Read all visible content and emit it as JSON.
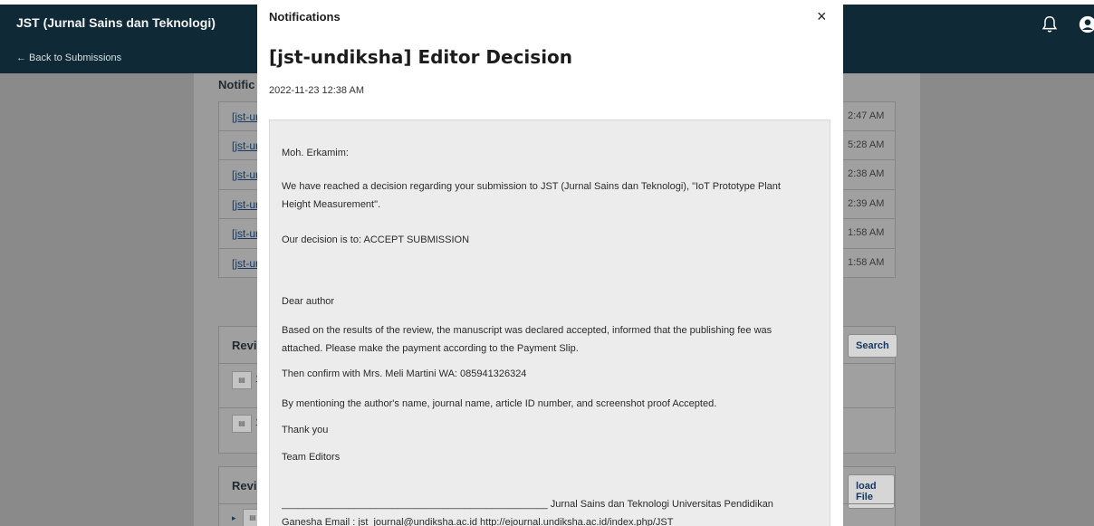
{
  "app": {
    "title": "JST (Jurnal Sains dan Teknologi)",
    "back_label": "← Back to Submissions"
  },
  "background": {
    "notifications_heading": "Notific",
    "rows": [
      {
        "link": "[jst-ur",
        "time": "2:47 AM"
      },
      {
        "link": "[jst-ur",
        "time": "5:28 AM"
      },
      {
        "link": "[jst-ur",
        "time": "2:38 AM"
      },
      {
        "link": "[jst-ur",
        "time": "2:39 AM"
      },
      {
        "link": "[jst-ur",
        "time": "1:58 AM"
      },
      {
        "link": "[jst-ur",
        "time": "1:58 AM"
      }
    ],
    "review_section": {
      "title": "Revie",
      "button": "Search",
      "file_rows": [
        "1",
        "1"
      ]
    },
    "revisions_section": {
      "title": "Revis",
      "button": "load File"
    }
  },
  "modal": {
    "header_label": "Notifications",
    "close_symbol": "×",
    "title": "[jst-undiksha] Editor Decision",
    "date": "2022-11-23 12:38 AM",
    "message": {
      "greeting": "Moh. Erkamim:",
      "para1_line1": "We have reached a decision regarding your submission to JST (Jurnal Sains dan Teknologi), \"IoT Prototype Plant",
      "para1_line2": "Height Measurement\".",
      "decision": "Our decision is to: ACCEPT SUBMISSION",
      "dear": "Dear author",
      "para2_line1": "Based on the results of the review, the manuscript was declared accepted, informed that the publishing fee was",
      "para2_line2": "attached. Please make the payment according to the Payment Slip.",
      "confirm": "Then confirm with Mrs. Meli Martini WA: 085941326324",
      "mention": "By mentioning the author's name, journal name, article ID number, and screenshot proof Accepted.",
      "thanks": "Thank you",
      "team": "Team Editors",
      "signature_line1": "________________________________________________ Jurnal Sains dan Teknologi Universitas Pendidikan",
      "signature_line2": "Ganesha Email : jst_journal@undiksha.ac.id http://ejournal.undiksha.ac.id/index.php/JST"
    }
  },
  "icons": {
    "bell": "bell-icon",
    "user": "user-icon",
    "close": "close-icon",
    "file": "file-icon"
  },
  "colors": {
    "topbar": "#0f2a36",
    "overlay": "#8a8a8a",
    "link": "#163a63"
  }
}
